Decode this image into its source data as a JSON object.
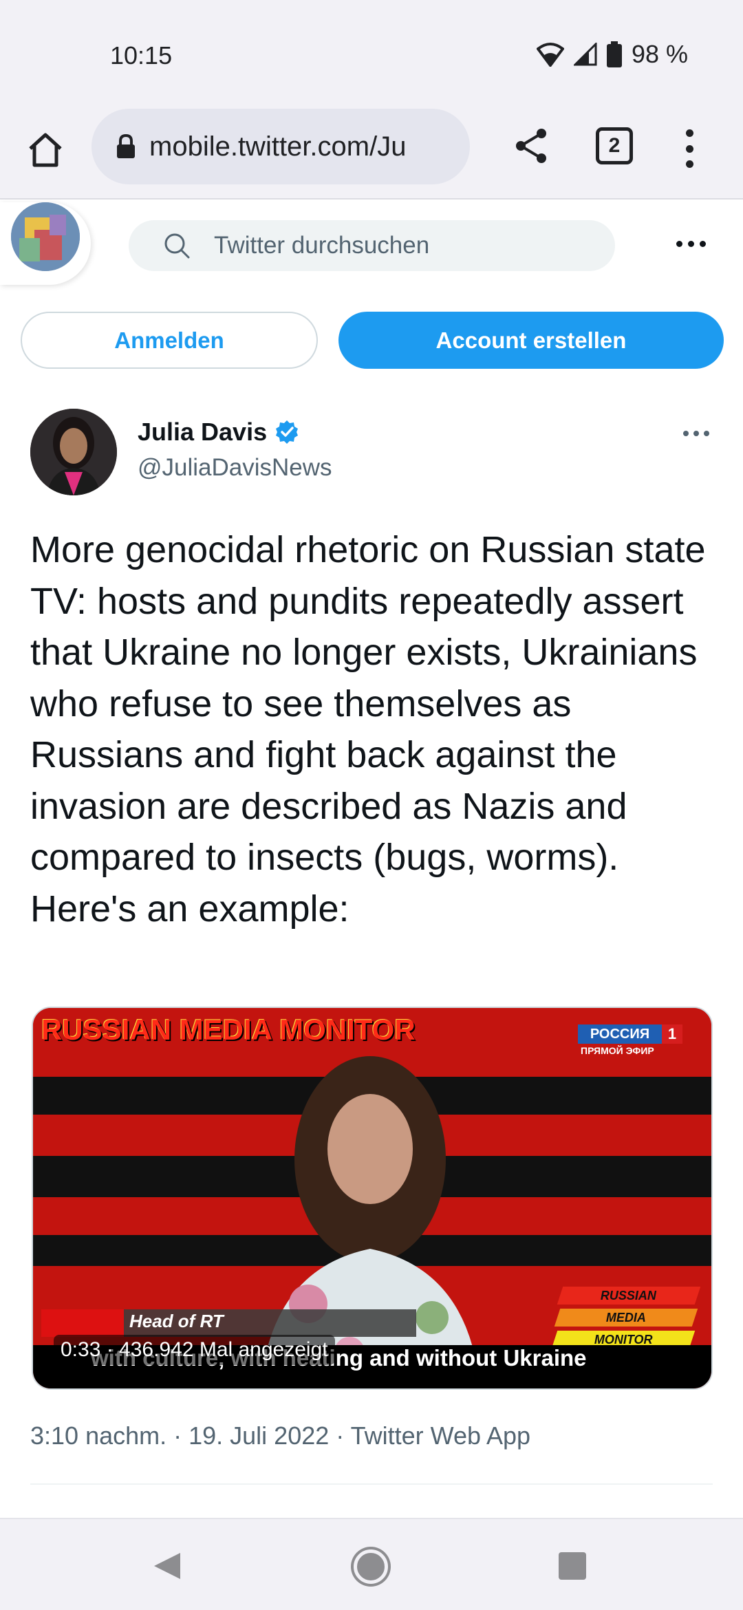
{
  "status_bar": {
    "time": "10:15",
    "battery": "98 %"
  },
  "browser": {
    "url": "mobile.twitter.com/Ju",
    "tab_count": "2",
    "icons": [
      "home-icon",
      "lock-icon",
      "share-icon",
      "tabs-icon",
      "overflow-menu-icon"
    ]
  },
  "twitter_header": {
    "search_placeholder": "Twitter durchsuchen"
  },
  "auth": {
    "login_label": "Anmelden",
    "signup_label": "Account erstellen"
  },
  "tweet": {
    "author_name": "Julia Davis",
    "verified": true,
    "author_handle": "@JuliaDavisNews",
    "text": "More genocidal rhetoric on Russian state TV: hosts and pundits repeatedly assert that Ukraine no longer exists, Ukrainians who refuse to see themselves as Russians and fight back against the invasion are described as Nazis and compared to insects (bugs, worms). Here's an example:",
    "media": {
      "overlay_title": "RUSSIAN MEDIA MONITOR",
      "channel_name": "РОССИЯ",
      "channel_number": "1",
      "channel_sub": "ПРЯМОЙ ЭФИР",
      "lower_third": "Head of RT",
      "subtitle": "with culture, with heating and without Ukraine",
      "duration_and_views": "0:33 · 436.942 Mal angezeigt",
      "badge_lines": [
        "RUSSIAN",
        "MEDIA",
        "MONITOR"
      ]
    },
    "meta": "3:10 nachm. · 19. Juli 2022 · Twitter Web App"
  },
  "colors": {
    "twitter_blue": "#1d9bf0",
    "secondary_text": "#536471",
    "browser_chrome": "#f2f1f6"
  }
}
